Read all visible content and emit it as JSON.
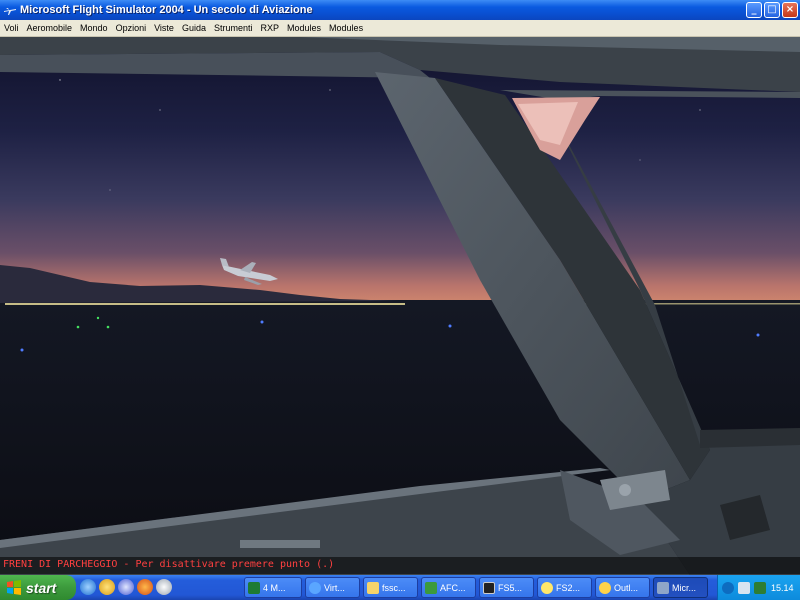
{
  "window": {
    "title": "Microsoft Flight Simulator 2004 - Un secolo di Aviazione",
    "controls": {
      "minimize": "_",
      "maximize": "□",
      "close": "×"
    }
  },
  "menu": [
    "Voli",
    "Aeromobile",
    "Mondo",
    "Opzioni",
    "Viste",
    "Guida",
    "Strumenti",
    "RXP",
    "Modules",
    "Modules"
  ],
  "status_message": "FRENI DI PARCHEGGIO - Per disattivare premere punto (.)",
  "taskbar": {
    "start_label": "start",
    "quick_launch_icons": [
      "internet-explorer-icon",
      "outlook-icon",
      "media-player-icon",
      "firefox-icon",
      "app-icon"
    ],
    "tasks": [
      {
        "label": "4 M...",
        "icon": "excel-icon"
      },
      {
        "label": "Virt...",
        "icon": "ie-icon"
      },
      {
        "label": "fssc...",
        "icon": "folder-icon"
      },
      {
        "label": "AFC...",
        "icon": "plane-icon"
      },
      {
        "label": "FS5...",
        "icon": "console-icon"
      },
      {
        "label": "FS2...",
        "icon": "fs-icon"
      },
      {
        "label": "Outl...",
        "icon": "outlook-icon"
      },
      {
        "label": "Micr...",
        "icon": "fs-icon"
      }
    ],
    "clock": "15.14"
  },
  "colors": {
    "titlebar": "#0a5ae0",
    "status_text": "#ff4040",
    "taskbar": "#245ddb",
    "start": "#3c9a3c"
  }
}
